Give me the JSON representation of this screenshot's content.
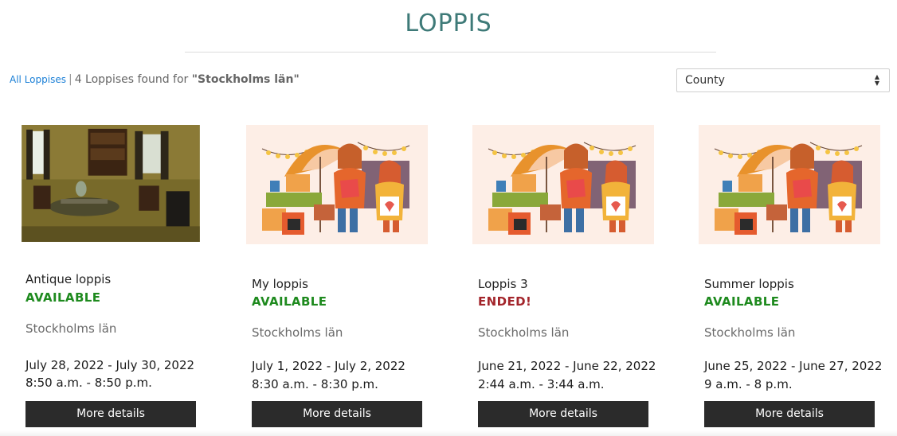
{
  "page": {
    "title": "LOPPIS"
  },
  "filter": {
    "all_link": "All Loppises",
    "separator": "|",
    "found_text": "4 Loppises found for",
    "query": "\"Stockholms län\""
  },
  "county_select": {
    "selected": "County"
  },
  "cards": [
    {
      "name": "Antique loppis",
      "status": "AVAILABLE",
      "county": "Stockholms län",
      "dates": "July 28, 2022 - July 30, 2022",
      "times": "8:50 a.m. - 8:50 p.m.",
      "button": "More details",
      "image": "antique-room-photo"
    },
    {
      "name": "My loppis",
      "status": "AVAILABLE",
      "county": "Stockholms län",
      "dates": "July 1, 2022 - July 2, 2022",
      "times": "8:30 a.m. - 8:30 p.m.",
      "button": "More details",
      "image": "flea-market-illustration"
    },
    {
      "name": "Loppis 3",
      "status": "ENDED!",
      "county": "Stockholms län",
      "dates": "June 21, 2022 - June 22, 2022",
      "times": "2:44 a.m. - 3:44 a.m.",
      "button": "More details",
      "image": "flea-market-illustration"
    },
    {
      "name": "Summer loppis",
      "status": "AVAILABLE",
      "county": "Stockholms län",
      "dates": "June 25, 2022 - June 27, 2022",
      "times": "9 a.m. - 8 p.m.",
      "button": "More details",
      "image": "flea-market-illustration"
    }
  ],
  "colors": {
    "title": "#3e7a78",
    "available": "#1e8a1e",
    "ended": "#a3252b",
    "button_bg": "#2b2b2b",
    "link": "#1a7fd6"
  }
}
